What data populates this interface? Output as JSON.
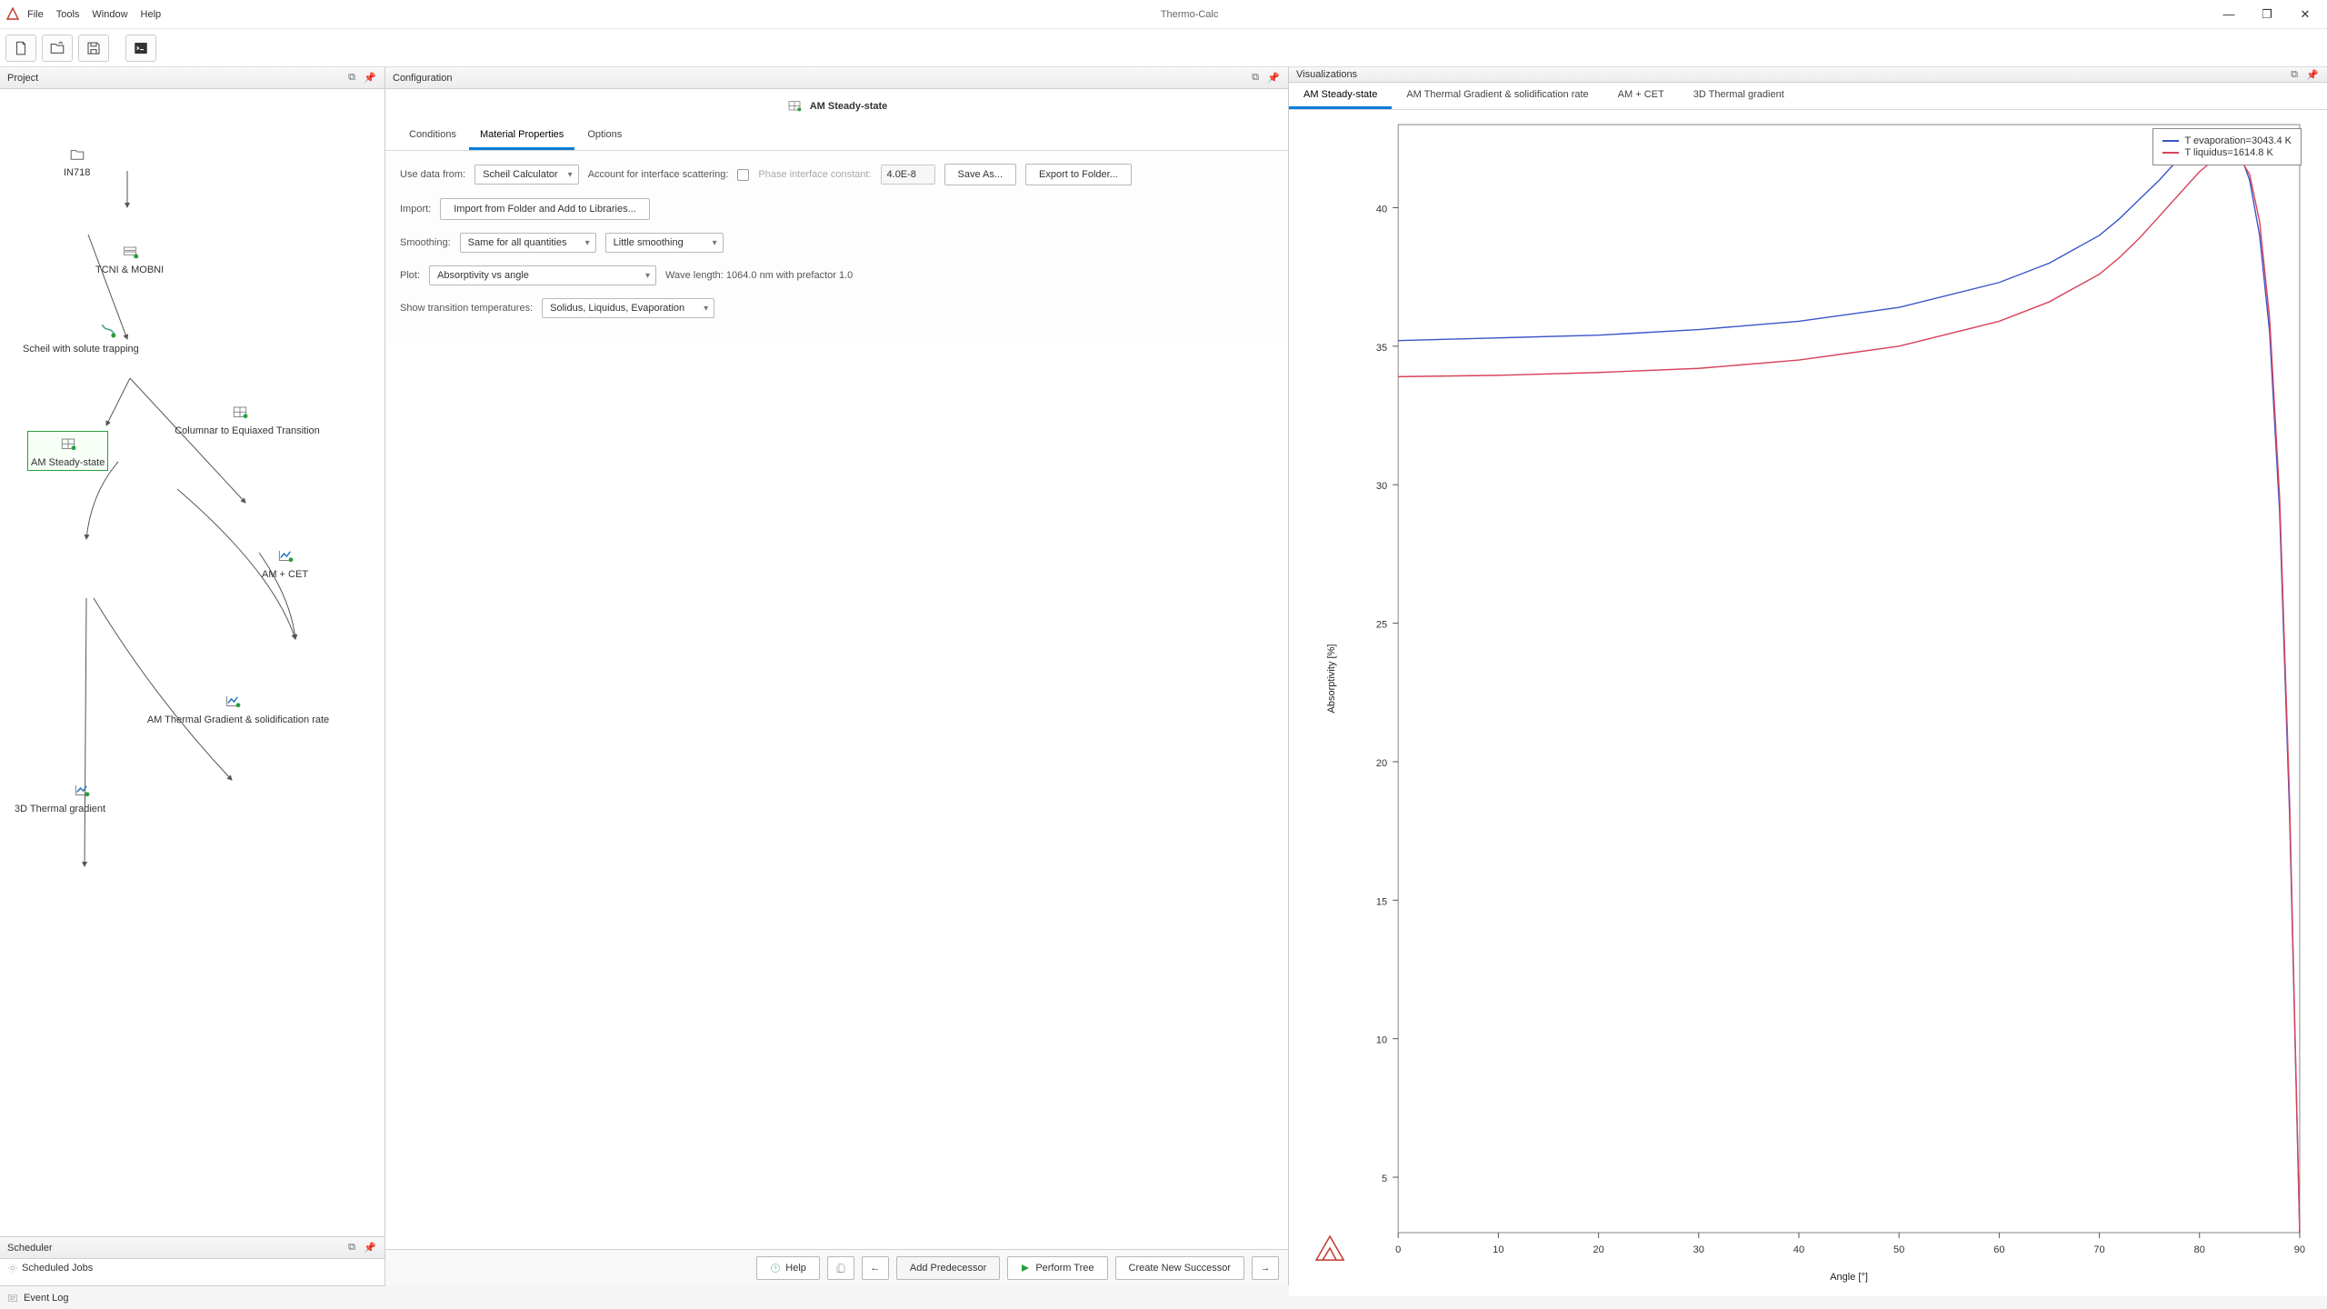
{
  "app": {
    "title": "Thermo-Calc"
  },
  "menu": {
    "file": "File",
    "tools": "Tools",
    "window": "Window",
    "help": "Help"
  },
  "panels": {
    "project": "Project",
    "configuration": "Configuration",
    "visualizations": "Visualizations",
    "scheduler": "Scheduler",
    "scheduled_jobs": "Scheduled Jobs",
    "event_log": "Event Log"
  },
  "project_nodes": {
    "in718": "IN718",
    "tcni": "TCNI & MOBNI",
    "scheil": "Scheil with solute trapping",
    "am_steady": "AM Steady-state",
    "cet": "Columnar to Equiaxed Transition",
    "am_cet": "AM + CET",
    "grad_rate": "AM Thermal Gradient & solidification rate",
    "grad_3d": "3D Thermal gradient"
  },
  "config": {
    "title": "AM Steady-state",
    "tabs": {
      "conditions": "Conditions",
      "material": "Material Properties",
      "options": "Options"
    },
    "use_data_from_label": "Use data from:",
    "use_data_from_value": "Scheil Calculator",
    "scatter_label": "Account for interface scattering:",
    "phase_const_label": "Phase interface constant:",
    "phase_const_value": "4.0E-8",
    "save_as": "Save As...",
    "export": "Export to Folder...",
    "import_label": "Import:",
    "import_btn": "Import from Folder and Add to Libraries...",
    "smoothing_label": "Smoothing:",
    "smoothing_v1": "Same for all quantities",
    "smoothing_v2": "Little smoothing",
    "plot_label": "Plot:",
    "plot_value": "Absorptivity vs angle",
    "wavelength": "Wave length: 1064.0 nm with prefactor 1.0",
    "transition_label": "Show transition temperatures:",
    "transition_value": "Solidus, Liquidus, Evaporation"
  },
  "footer": {
    "help": "Help",
    "add_pred": "Add Predecessor",
    "perform": "Perform Tree",
    "new_succ": "Create New Successor"
  },
  "viz_tabs": {
    "t1": "AM Steady-state",
    "t2": "AM Thermal Gradient & solidification rate",
    "t3": "AM + CET",
    "t4": "3D Thermal gradient"
  },
  "legend": {
    "evap": "T evaporation=3043.4 K",
    "liq": "T liquidus=1614.8 K"
  },
  "chart_data": {
    "type": "line",
    "title": "",
    "xlabel": "Angle [°]",
    "ylabel": "Absorptivity [%]",
    "xlim": [
      0,
      90
    ],
    "ylim": [
      3,
      43
    ],
    "x_ticks": [
      0,
      10,
      20,
      30,
      40,
      50,
      60,
      70,
      80,
      90
    ],
    "y_ticks": [
      5,
      10,
      15,
      20,
      25,
      30,
      35,
      40
    ],
    "series": [
      {
        "name": "T evaporation=3043.4 K",
        "color": "#3a55c8",
        "x": [
          0,
          10,
          20,
          30,
          40,
          50,
          60,
          65,
          70,
          72,
          74,
          76,
          78,
          80,
          82,
          83,
          84,
          85,
          86,
          87,
          88,
          89,
          90
        ],
        "y": [
          35.2,
          35.3,
          35.4,
          35.6,
          35.9,
          36.4,
          37.3,
          38.0,
          39.0,
          39.6,
          40.3,
          41.0,
          41.8,
          42.4,
          42.6,
          42.4,
          42.0,
          41.0,
          39.0,
          35.5,
          29.0,
          18.0,
          3.0
        ]
      },
      {
        "name": "T liquidus=1614.8 K",
        "color": "#d8425a",
        "x": [
          0,
          10,
          20,
          30,
          40,
          50,
          60,
          65,
          70,
          72,
          74,
          76,
          78,
          80,
          82,
          83,
          84,
          85,
          86,
          87,
          88,
          89,
          90
        ],
        "y": [
          33.9,
          33.95,
          34.05,
          34.2,
          34.5,
          35.0,
          35.9,
          36.6,
          37.6,
          38.2,
          38.9,
          39.7,
          40.5,
          41.3,
          41.9,
          42.0,
          41.8,
          41.2,
          39.5,
          36.0,
          29.5,
          18.5,
          3.0
        ]
      }
    ]
  }
}
